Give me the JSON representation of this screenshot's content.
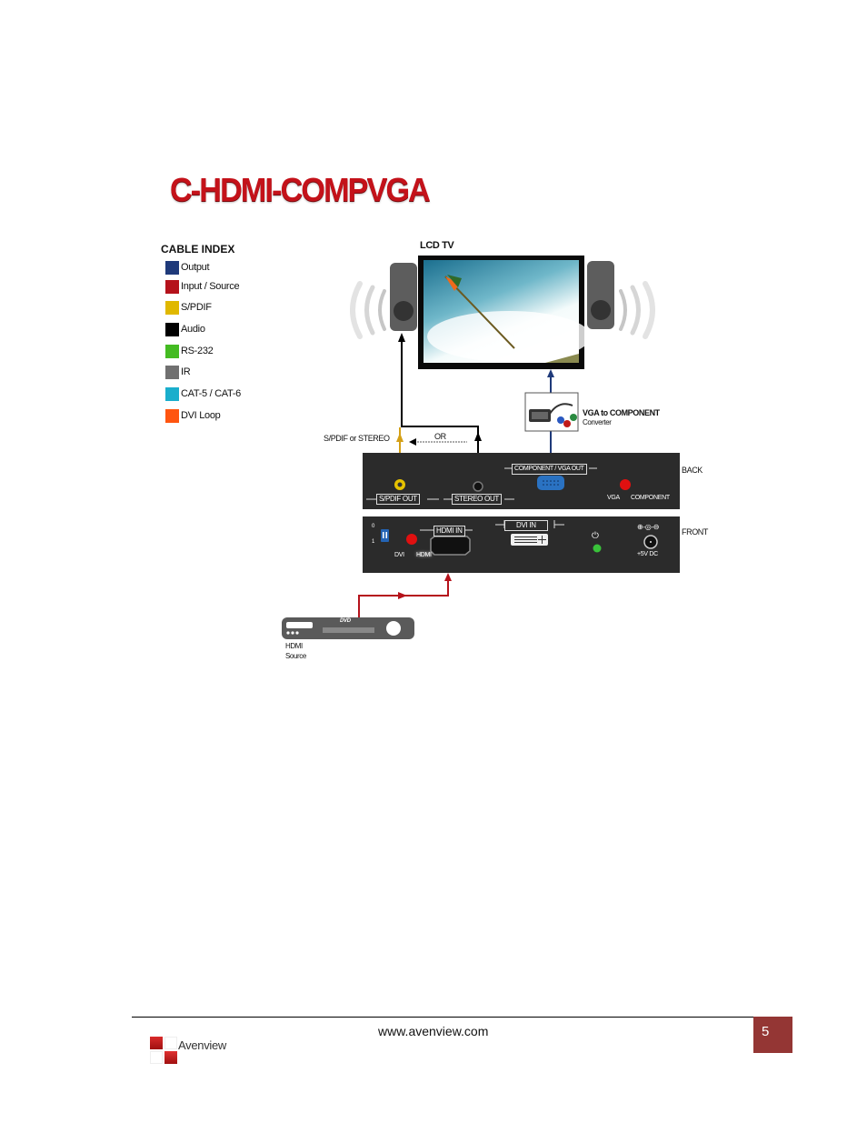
{
  "document": {
    "title": "C-HDMI-COMPVGA",
    "cable_index": {
      "heading": "CABLE INDEX",
      "items": [
        {
          "label": "Output",
          "color": "#1f3a7a"
        },
        {
          "label": "Input / Source",
          "color": "#b5121b"
        },
        {
          "label": "S/PDIF",
          "color": "#e0b800"
        },
        {
          "label": "Audio",
          "color": "#000000"
        },
        {
          "label": "RS-232",
          "color": "#44bb22"
        },
        {
          "label": "IR",
          "color": "#707070"
        },
        {
          "label": "CAT-5 / CAT-6",
          "color": "#1aaecc"
        },
        {
          "label": "DVI Loop",
          "color": "#ff5510"
        }
      ]
    },
    "diagram": {
      "tv_label": "LCD TV",
      "converter_label": "VGA to COMPONENT",
      "converter_sublabel": "Converter",
      "spdif_or_stereo": "S/PDIF or STEREO",
      "or_label": "OR",
      "back_label": "BACK",
      "front_label": "FRONT",
      "back_panel": {
        "spdif_out": "S/PDIF OUT",
        "stereo_out": "STEREO OUT",
        "component_vga_out": "COMPONENT / VGA OUT",
        "vga": "VGA",
        "component": "COMPONENT"
      },
      "front_panel": {
        "switch_0": "0",
        "switch_1": "1",
        "dvi": "DVI",
        "hdmi": "HDMI",
        "hdmi_in": "HDMI IN",
        "dvi_in": "DVI IN",
        "power_symbol": "⏻",
        "polarity": "⊕-◎-⊖",
        "power_in": "+5V DC"
      },
      "source_label_1": "HDMI",
      "source_label_2": "Source",
      "dvd_logo": "DVD"
    },
    "colors": {
      "title_red": "#c4121a",
      "output_line": "#1f3a7a",
      "input_line": "#b5121b",
      "spdif_line": "#d4a017",
      "panel": "#2b2b2b"
    }
  },
  "footer": {
    "url": "www.avenview.com",
    "page_number": "5",
    "logo_text": "Avenview"
  }
}
